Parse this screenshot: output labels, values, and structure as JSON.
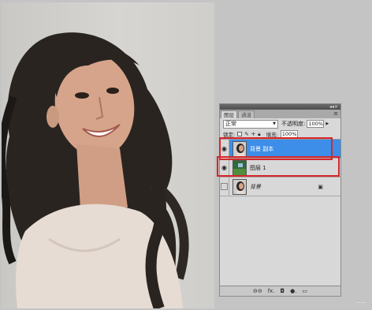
{
  "panel": {
    "collapse_icon": "double-chevron-icon",
    "close_label": "×",
    "tabs": [
      {
        "label": "图层",
        "active": true
      },
      {
        "label": "通道",
        "active": false
      }
    ],
    "menu_icon": "≡",
    "blend_mode": "正常",
    "opacity_label": "不透明度:",
    "opacity_value": "100%",
    "lock_label": "锁定:",
    "fill_label": "填充:",
    "fill_value": "100%",
    "layers": [
      {
        "name": "背景 副本",
        "visible": true,
        "selected": true
      },
      {
        "name": "图层 1",
        "visible": true,
        "selected": false
      },
      {
        "name": "背景",
        "visible": false,
        "selected": false,
        "locked": true
      }
    ],
    "bottom_tools": [
      "link-icon",
      "fx",
      "mask-icon",
      "adjustment-icon"
    ],
    "bottom_labels": {
      "link": "⊖⊖",
      "fx": "fx.",
      "mask": "◘",
      "adjust": "●.",
      "group": "▭"
    }
  },
  "colors": {
    "selection": "#3d8ee8",
    "highlight_box": "#d6262a",
    "panel_bg": "#d8d8d8",
    "workspace": "#c4c4c4"
  },
  "watermark": "⎯⎯⎯"
}
